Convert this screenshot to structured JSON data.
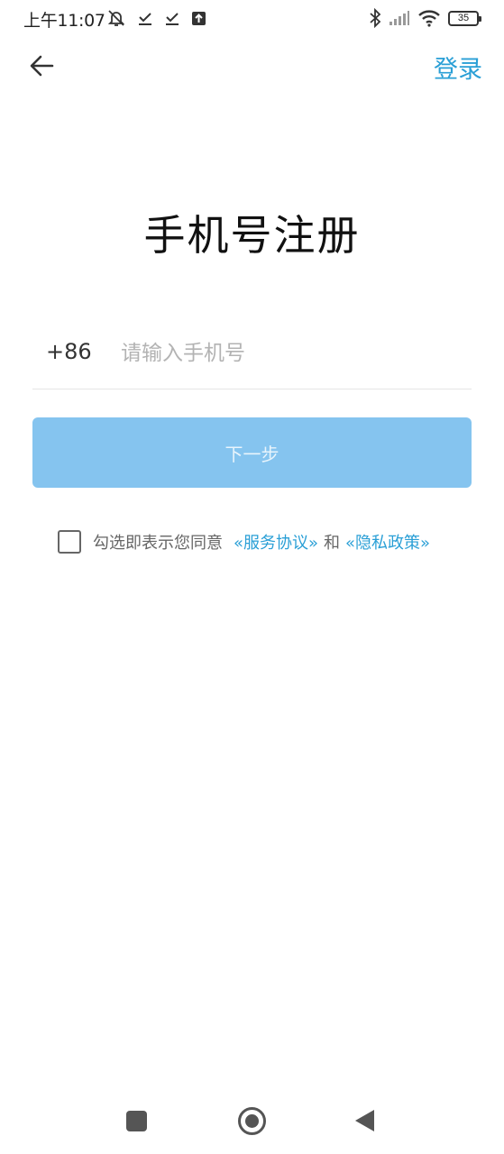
{
  "status_bar": {
    "time": "上午11:07",
    "battery": "35",
    "icons_left": [
      "alarm-off-icon",
      "download-done-icon",
      "download-done-icon",
      "upload-icon"
    ],
    "icons_right": [
      "bluetooth-icon",
      "signal-icon",
      "wifi-icon",
      "battery-icon"
    ]
  },
  "nav": {
    "back_icon": "arrow-left-icon",
    "login_label": "登录"
  },
  "title": "手机号注册",
  "phone": {
    "country_code": "+86",
    "placeholder": "请输入手机号",
    "value": ""
  },
  "next_button_label": "下一步",
  "agreement": {
    "prefix": "勾选即表示您同意",
    "terms_link": "«服务协议»",
    "and": "和",
    "privacy_link": "«隐私政策»",
    "checked": false
  },
  "colors": {
    "accent": "#2a9fd6",
    "button_disabled": "#85c4ef"
  }
}
